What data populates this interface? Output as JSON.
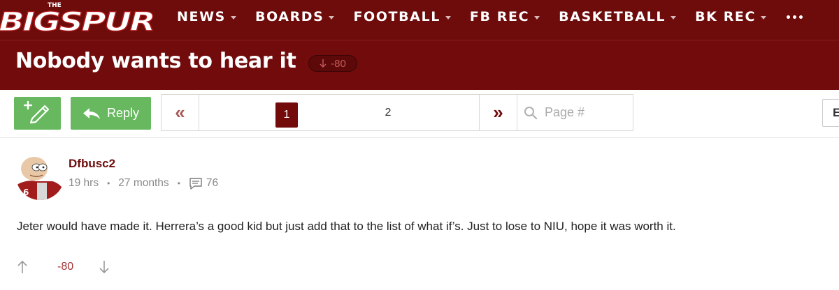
{
  "site": {
    "logo_text_small": "THE",
    "logo_text": "BIGSPUR",
    "brand_color": "#6e0b0b",
    "nav": [
      {
        "label": "NEWS"
      },
      {
        "label": "BOARDS"
      },
      {
        "label": "FOOTBALL"
      },
      {
        "label": "FB REC"
      },
      {
        "label": "BASKETBALL"
      },
      {
        "label": "BK REC"
      }
    ],
    "more_icon": "ellipsis-icon"
  },
  "thread": {
    "title": "Nobody wants to hear it",
    "score": "-80"
  },
  "toolbar": {
    "new_icon": "new-post-pencil-icon",
    "reply_label": "Reply",
    "reply_icon": "reply-arrow-icon",
    "pagination": {
      "first_icon": "double-chevron-left-icon",
      "pages": [
        "1",
        "2"
      ],
      "current_page": "1",
      "last_icon": "double-chevron-right-icon",
      "search_icon": "search-icon",
      "placeholder": "Page #"
    },
    "edge_button_label": "E"
  },
  "post": {
    "username": "Dfbusc2",
    "posted_ago": "19 hrs",
    "member_for": "27 months",
    "post_count": "76",
    "body": "Jeter would have made it. Herrera’s a good kid but just add that to the list of what if’s. Just to lose to NIU, hope it was worth it.",
    "score": "-80",
    "colors": {
      "username": "#6e0b0b",
      "score": "#a33333",
      "button_green": "#67b85f"
    }
  }
}
